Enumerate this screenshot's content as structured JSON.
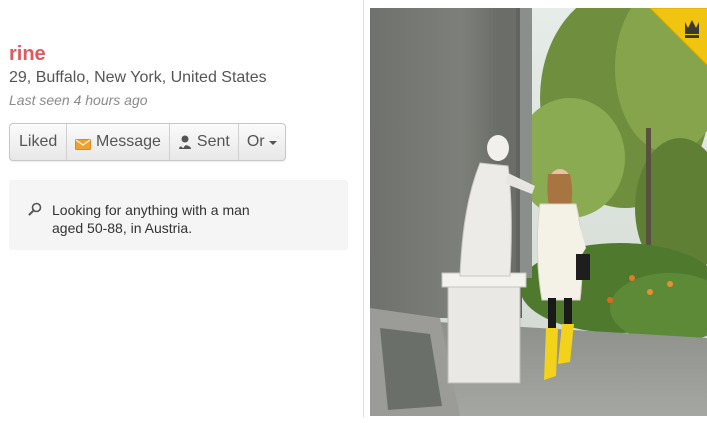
{
  "profile": {
    "name": "rine",
    "location": "29, Buffalo, New York, United States",
    "last_seen": "Last seen 4 hours ago"
  },
  "actions": {
    "liked_label": "Liked",
    "message_label": "Message",
    "sent_label": "Sent",
    "more_label": "Or"
  },
  "looking_for": {
    "icon": "search-icon",
    "text": "Looking for anything with a man aged 50-88, in Austria."
  },
  "photo": {
    "badge_icon": "crown-icon",
    "badge_color": "#f1c40f"
  },
  "colors": {
    "name": "#e3595b",
    "text": "#555555",
    "muted": "#8a8a8a",
    "panel": "#f5f5f5",
    "envelope": "#f0a22e"
  }
}
